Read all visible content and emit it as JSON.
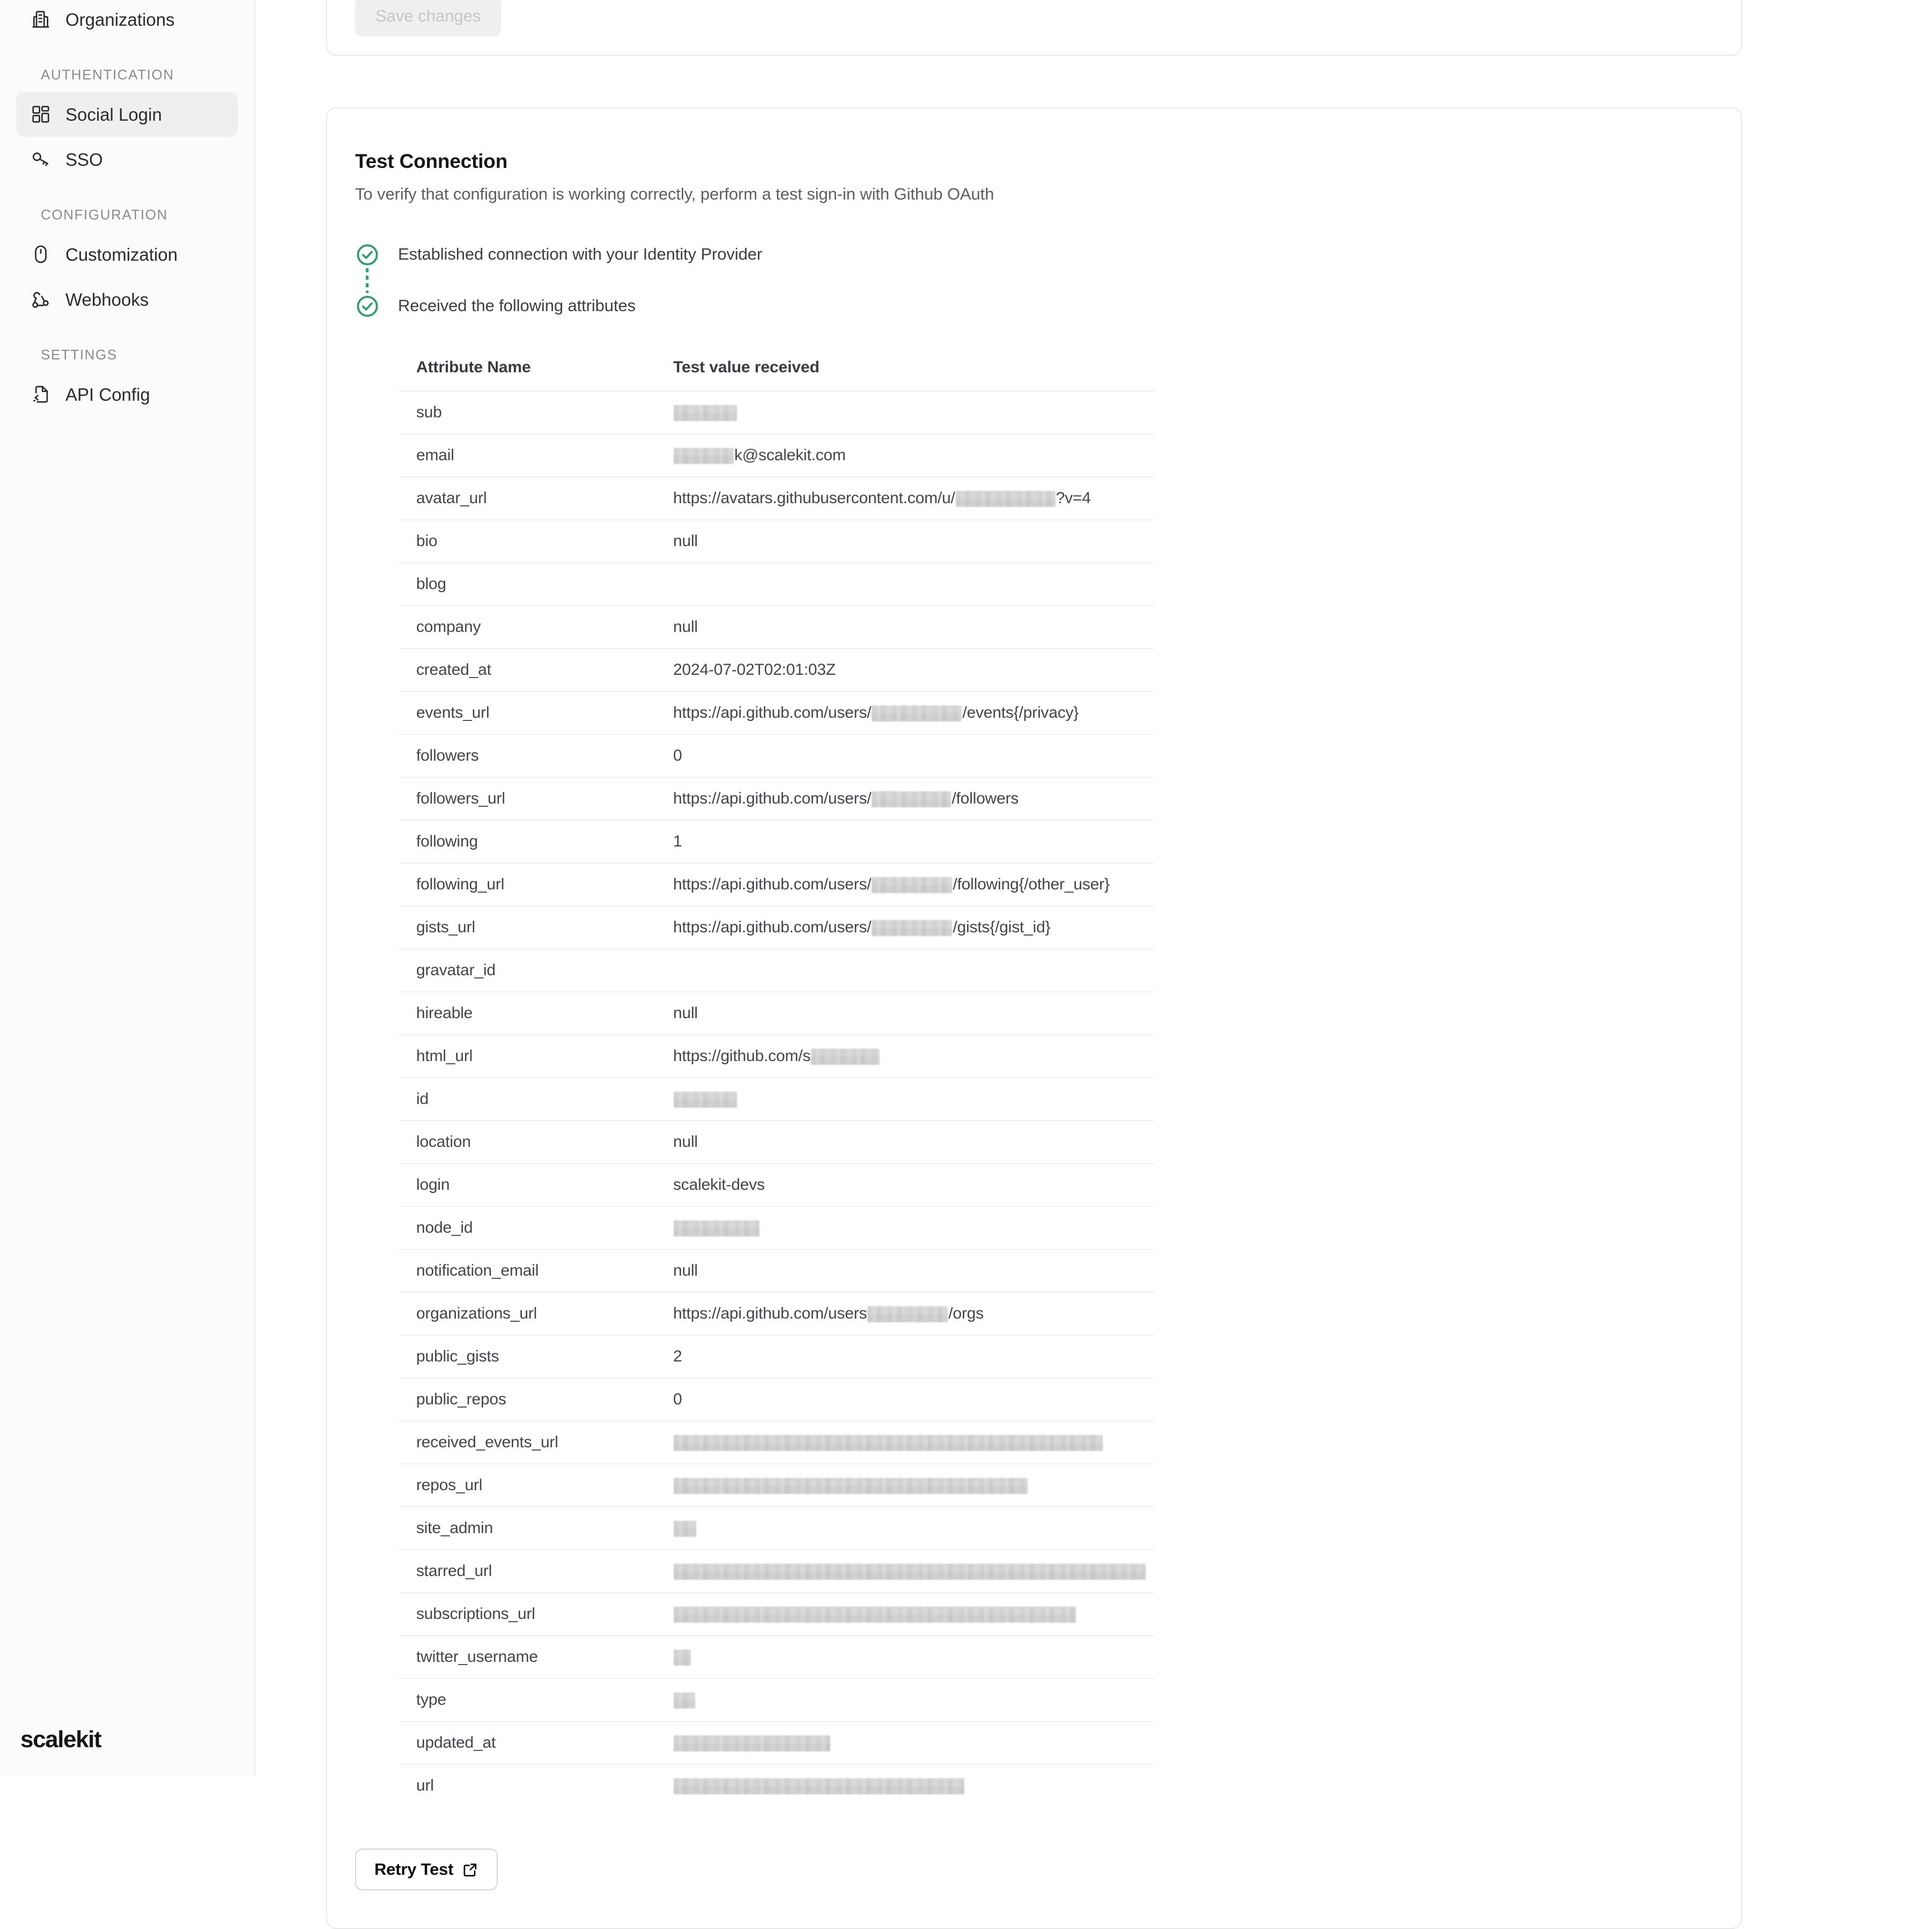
{
  "sidebar": {
    "brand": "scalekit",
    "items": [
      {
        "label": "Organizations",
        "icon": "building-icon",
        "active": false
      },
      {
        "label": "Social Login",
        "icon": "grid-icon",
        "active": true
      },
      {
        "label": "SSO",
        "icon": "key-icon",
        "active": false
      },
      {
        "label": "Customization",
        "icon": "mouse-icon",
        "active": false
      },
      {
        "label": "Webhooks",
        "icon": "webhook-icon",
        "active": false
      },
      {
        "label": "API Config",
        "icon": "file-code-icon",
        "active": false
      }
    ],
    "sections": {
      "authentication": "AUTHENTICATION",
      "configuration": "CONFIGURATION",
      "settings": "SETTINGS"
    }
  },
  "top_card": {
    "save_label": "Save changes",
    "save_disabled": true
  },
  "test_connection": {
    "title": "Test Connection",
    "subtitle": "To verify that configuration is working correctly, perform a test sign-in with Github OAuth",
    "steps": [
      {
        "label": "Established connection with your Identity Provider",
        "status": "success"
      },
      {
        "label": "Received the following attributes",
        "status": "success"
      }
    ],
    "status_color": "#2f9e6a",
    "retry_label": "Retry Test",
    "retry_icon": "external-link-icon",
    "table": {
      "columns": [
        "Attribute Name",
        "Test value received"
      ],
      "rows": [
        {
          "name": "sub",
          "value": "",
          "redacted": [
            118
          ]
        },
        {
          "name": "email",
          "value": "k@scalekit.com",
          "redacted": [
            112
          ],
          "redact_position": "prefix"
        },
        {
          "name": "avatar_url",
          "value": "https://avatars.githubusercontent.com/u/",
          "value_suffix": "?v=4",
          "redacted": [
            186
          ]
        },
        {
          "name": "bio",
          "value": "null"
        },
        {
          "name": "blog",
          "value": ""
        },
        {
          "name": "company",
          "value": "null"
        },
        {
          "name": "created_at",
          "value": "2024-07-02T02:01:03Z"
        },
        {
          "name": "events_url",
          "value": "https://api.github.com/users/",
          "value_suffix": "/events{/privacy}",
          "redacted": [
            168
          ]
        },
        {
          "name": "followers",
          "value": "0"
        },
        {
          "name": "followers_url",
          "value": "https://api.github.com/users/",
          "value_suffix": "/followers",
          "redacted": [
            148
          ]
        },
        {
          "name": "following",
          "value": "1"
        },
        {
          "name": "following_url",
          "value": "https://api.github.com/users/",
          "value_suffix": "/following{/other_user}",
          "redacted": [
            150
          ]
        },
        {
          "name": "gists_url",
          "value": "https://api.github.com/users/",
          "value_suffix": "/gists{/gist_id}",
          "redacted": [
            150
          ]
        },
        {
          "name": "gravatar_id",
          "value": ""
        },
        {
          "name": "hireable",
          "value": "null"
        },
        {
          "name": "html_url",
          "value": "https://github.com/s",
          "redacted": [
            128
          ]
        },
        {
          "name": "id",
          "value": "",
          "redacted": [
            118
          ]
        },
        {
          "name": "location",
          "value": "null"
        },
        {
          "name": "login",
          "value": "scalekit-devs"
        },
        {
          "name": "node_id",
          "value": "",
          "redacted": [
            160
          ]
        },
        {
          "name": "notification_email",
          "value": "null"
        },
        {
          "name": "organizations_url",
          "value": "https://api.github.com/users",
          "value_suffix": "/orgs",
          "redacted": [
            150
          ]
        },
        {
          "name": "public_gists",
          "value": "2"
        },
        {
          "name": "public_repos",
          "value": "0"
        },
        {
          "name": "received_events_url",
          "value": "",
          "redacted": [
            800
          ]
        },
        {
          "name": "repos_url",
          "value": "",
          "redacted": [
            660
          ]
        },
        {
          "name": "site_admin",
          "value": "",
          "redacted": [
            42
          ]
        },
        {
          "name": "starred_url",
          "value": "",
          "redacted": [
            880
          ]
        },
        {
          "name": "subscriptions_url",
          "value": "",
          "redacted": [
            750
          ]
        },
        {
          "name": "twitter_username",
          "value": "",
          "redacted": [
            32
          ]
        },
        {
          "name": "type",
          "value": "",
          "redacted": [
            40
          ]
        },
        {
          "name": "updated_at",
          "value": "",
          "redacted": [
            292
          ]
        },
        {
          "name": "url",
          "value": "",
          "redacted": [
            542
          ]
        }
      ]
    }
  }
}
